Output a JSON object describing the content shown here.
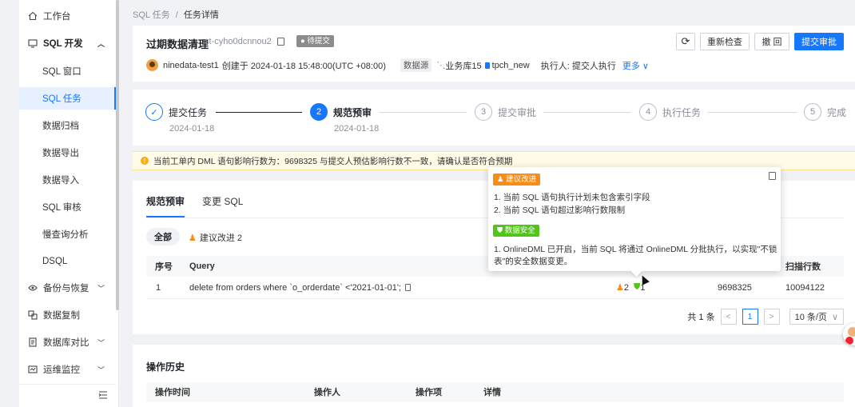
{
  "sidebar": {
    "items": [
      {
        "label": "工作台",
        "icon": "home-icon"
      },
      {
        "label": "SQL 开发",
        "icon": "monitor-icon",
        "caret": "^"
      },
      {
        "label": "SQL 窗口"
      },
      {
        "label": "SQL 任务"
      },
      {
        "label": "数据归档"
      },
      {
        "label": "数据导出"
      },
      {
        "label": "数据导入"
      },
      {
        "label": "SQL 审核"
      },
      {
        "label": "慢查询分析"
      },
      {
        "label": "DSQL"
      },
      {
        "label": "备份与恢复",
        "icon": "backup-icon",
        "caret": "v"
      },
      {
        "label": "数据复制",
        "icon": "replicate-icon"
      },
      {
        "label": "数据库对比",
        "icon": "compare-icon",
        "caret": "v"
      },
      {
        "label": "运维监控",
        "icon": "monitor-ops-icon",
        "caret": "v"
      }
    ],
    "collapse_icon": "menu-collapse-icon"
  },
  "breadcrumb": {
    "parent": "SQL 任务",
    "sep": "/",
    "current": "任务详情"
  },
  "header": {
    "title": "过期数据清理",
    "task_id": "st-cyho0dcnnou2",
    "status": "待提交",
    "user": "ninedata-test1",
    "created_text": "创建于 2024-01-18 15:48:00(UTC +08:00)",
    "datasource_label": "数据源",
    "datasource": "业务库15",
    "database": "tpch_new",
    "executor": "执行人:  提交人执行",
    "more": "更多",
    "buttons": {
      "refresh": "⟳",
      "recheck": "重新检查",
      "revoke": "撤 回",
      "submit": "提交审批"
    }
  },
  "steps": [
    {
      "num": "✓",
      "label": "提交任务",
      "date": "2024-01-18"
    },
    {
      "num": "2",
      "label": "规范预审",
      "date": "2024-01-18"
    },
    {
      "num": "3",
      "label": "提交审批"
    },
    {
      "num": "4",
      "label": "执行任务"
    },
    {
      "num": "5",
      "label": "完成"
    }
  ],
  "warning": "当前工单内 DML 语句影响行数为：9698325 与提交人预估影响行数不一致，请确认是否符合预期",
  "check": {
    "tabs": [
      "规范预审",
      "变更 SQL"
    ],
    "filters": {
      "all": "全部",
      "advice": "建议改进 2"
    },
    "columns": {
      "seq": "序号",
      "query": "Query",
      "scan": "扫描行数"
    },
    "rows": [
      {
        "seq": "1",
        "query": "delete from orders where `o_orderdate` <'2021-01-01';",
        "advice_count": "2",
        "safe_count": "1",
        "affected": "9698325",
        "scan": "10094122"
      }
    ],
    "pagination": {
      "total": "共 1 条",
      "prev": "<",
      "page": "1",
      "next": ">",
      "size": "10 条/页"
    }
  },
  "popover": {
    "advice_tag": "建议改进",
    "advice_lines": [
      "1. 当前 SQL 语句执行计划未包含索引字段",
      "2. 当前 SQL 语句超过影响行数限制"
    ],
    "security_tag": "数据安全",
    "security_lines": [
      "1. OnlineDML 已开启，当前 SQL 将通过 OnlineDML 分批执行，以实现\"不锁",
      "表\"的安全数据变更。"
    ]
  },
  "history": {
    "title": "操作历史",
    "columns": [
      "操作时间",
      "操作人",
      "操作项",
      "详情"
    ]
  },
  "colors": {
    "primary": "#1677ff",
    "warning": "#faad14",
    "advice": "#fa8c16",
    "safe": "#52c41a"
  }
}
